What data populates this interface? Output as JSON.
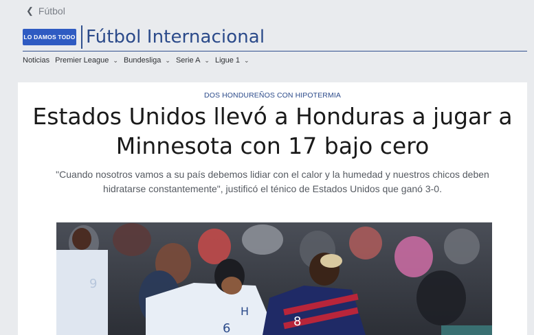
{
  "breadcrumb": {
    "back_label": "Fútbol"
  },
  "brand": {
    "logo_text": "LO DAMOS TODO",
    "section_title": "Fútbol Internacional"
  },
  "nav": {
    "items": [
      {
        "label": "Noticias",
        "has_dropdown": false
      },
      {
        "label": "Premier League",
        "has_dropdown": true
      },
      {
        "label": "Bundesliga",
        "has_dropdown": true
      },
      {
        "label": "Serie A",
        "has_dropdown": true
      },
      {
        "label": "Ligue 1",
        "has_dropdown": true
      }
    ]
  },
  "article": {
    "kicker": "DOS HONDUREÑOS CON HIPOTERMIA",
    "headline": "Estados Unidos llevó a Honduras a jugar a Minnesota con 17 bajo cero",
    "dek": "\"Cuando nosotros vamos a su país debemos lidiar con el calor y la humedad y nuestros chicos deben hidratarse constantemente\", justificó el ténico de Estados Unidos que ganó 3-0.",
    "photo": {
      "jersey_numbers": [
        "9",
        "6",
        "8"
      ],
      "crest_letter": "H"
    }
  },
  "colors": {
    "brand_blue": "#2f5bc2",
    "title_blue": "#2b4a8a"
  }
}
